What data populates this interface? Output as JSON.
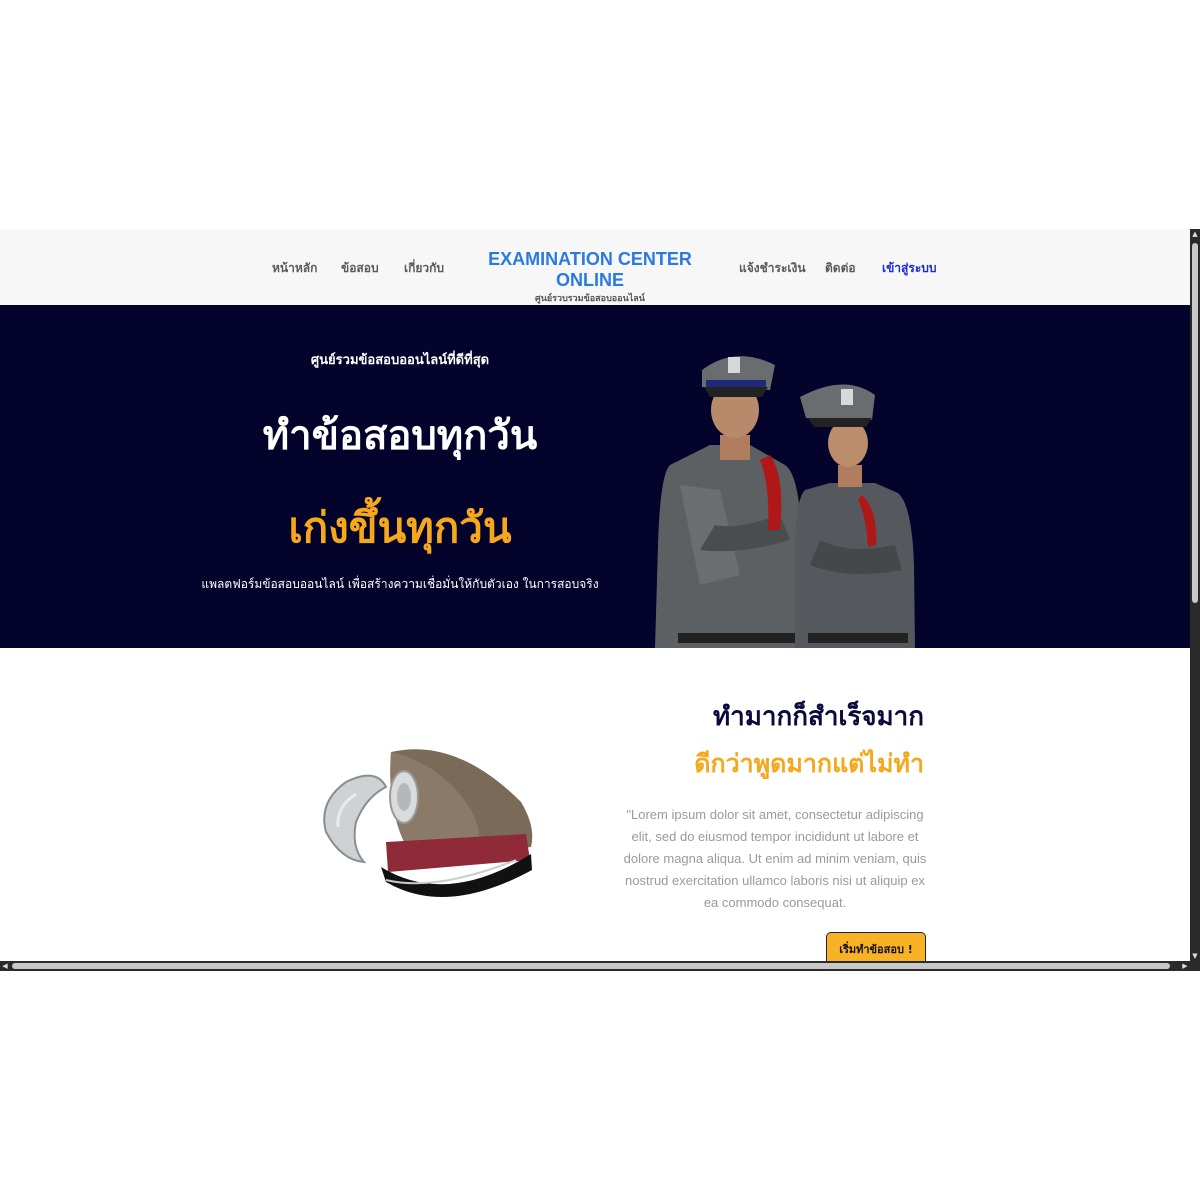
{
  "navbar": {
    "items_left": [
      {
        "label": "หน้าหลัก"
      },
      {
        "label": "ข้อสอบ"
      },
      {
        "label": "เกี่ยวกับ"
      }
    ],
    "brand_title": "EXAMINATION CENTER ONLINE",
    "brand_subtitle": "ศูนย์รวบรวมข้อสอบออนไลน์",
    "items_right": [
      {
        "label": "แจ้งชำระเงิน"
      },
      {
        "label": "ติดต่อ"
      },
      {
        "label": "เข้าสู่ระบบ"
      }
    ]
  },
  "hero": {
    "kicker": "ศูนย์รวมข้อสอบออนไลน์ที่ดีที่สุด",
    "title": "ทำข้อสอบทุกวัน",
    "subtitle": "เก่งขึ้นทุกวัน",
    "description": "แพลตฟอร์มข้อสอบออนไลน์ เพื่อสร้างความเชื่อมั่นให้กับตัวเอง ในการสอบจริง"
  },
  "feature": {
    "title": "ทำมากก็สำเร็จมาก",
    "subtitle": "ดีกว่าพูดมากแต่ไม่ทำ",
    "body": "\"Lorem ipsum dolor sit amet, consectetur adipiscing elit, sed do eiusmod tempor incididunt ut labore et dolore magna aliqua. Ut enim ad minim veniam, quis nostrud exercitation ullamco laboris nisi ut aliquip ex ea commodo consequat.",
    "button_label": "เริ่มทำข้อสอบ !"
  },
  "colors": {
    "brand_blue": "#2a7ae2",
    "hero_bg": "#03032b",
    "accent_orange": "#f5a81c",
    "login_link": "#1a2bd6"
  },
  "icons": [
    "scroll-up-arrow-icon",
    "scroll-down-arrow-icon",
    "scroll-left-arrow-icon",
    "scroll-right-arrow-icon"
  ]
}
